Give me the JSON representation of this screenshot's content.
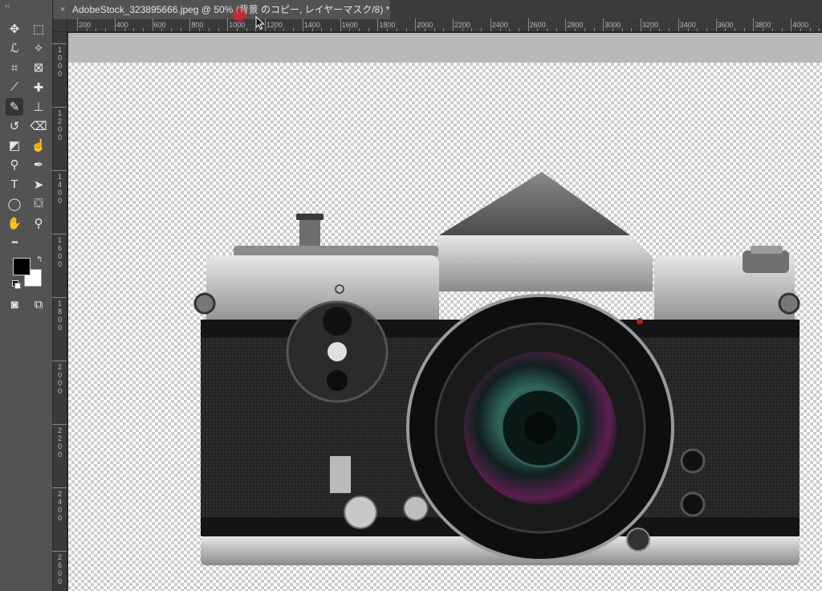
{
  "document_tab": {
    "title": "AdobeStock_323895666.jpeg @ 50% (背景 のコピー, レイヤーマスク/8) *",
    "close_glyph": "×"
  },
  "toolbar": {
    "grip": "‹‹",
    "tools": [
      {
        "name": "move-tool-icon",
        "glyph": "✥"
      },
      {
        "name": "rectangular-marquee-icon",
        "glyph": "⬚"
      },
      {
        "name": "lasso-tool-icon",
        "glyph": "ℒ"
      },
      {
        "name": "magic-wand-icon",
        "glyph": "✧"
      },
      {
        "name": "crop-tool-icon",
        "glyph": "⌗"
      },
      {
        "name": "frame-tool-icon",
        "glyph": "⊠"
      },
      {
        "name": "eyedropper-icon",
        "glyph": "⟋"
      },
      {
        "name": "healing-brush-icon",
        "glyph": "✚"
      },
      {
        "name": "brush-tool-icon",
        "glyph": "✎"
      },
      {
        "name": "clone-stamp-icon",
        "glyph": "⊥"
      },
      {
        "name": "history-brush-icon",
        "glyph": "↺"
      },
      {
        "name": "eraser-tool-icon",
        "glyph": "⌫"
      },
      {
        "name": "gradient-tool-icon",
        "glyph": "◩"
      },
      {
        "name": "smudge-tool-icon",
        "glyph": "☝"
      },
      {
        "name": "dodge-tool-icon",
        "glyph": "⚲"
      },
      {
        "name": "pen-tool-icon",
        "glyph": "✒"
      },
      {
        "name": "type-tool-icon",
        "glyph": "T"
      },
      {
        "name": "path-selection-icon",
        "glyph": "➤"
      },
      {
        "name": "ellipse-tool-icon",
        "glyph": "◯"
      },
      {
        "name": "paint-bucket-icon",
        "glyph": "⛋"
      },
      {
        "name": "hand-tool-icon",
        "glyph": "✋"
      },
      {
        "name": "zoom-tool-icon",
        "glyph": "⚲"
      },
      {
        "name": "more-tools-icon",
        "glyph": "•••"
      },
      {
        "name": "quick-mask-icon",
        "glyph": "◙"
      },
      {
        "name": "screen-mode-icon",
        "glyph": "⧉"
      }
    ],
    "active_tool": "brush-tool-icon",
    "foreground_color": "#000000",
    "background_color": "#ffffff",
    "swap_glyph": "↰"
  },
  "ruler_top": [
    "200",
    "400",
    "600",
    "800",
    "1000",
    "1200",
    "1400",
    "1600",
    "1800",
    "2000",
    "2200",
    "2400",
    "2600",
    "2800",
    "3000",
    "3200",
    "3400",
    "3600",
    "3800",
    "4000"
  ],
  "ruler_left": [
    "1000",
    "1200",
    "1400",
    "1600",
    "1800",
    "2000",
    "2200",
    "2400",
    "2600"
  ],
  "canvas": {
    "image_subject": "vintage-camera"
  },
  "colors": {
    "ui_panel": "#535353",
    "ui_dark": "#282828",
    "pasteboard": "#b9b9b9",
    "cursor_highlight": "#eb1e1e"
  }
}
